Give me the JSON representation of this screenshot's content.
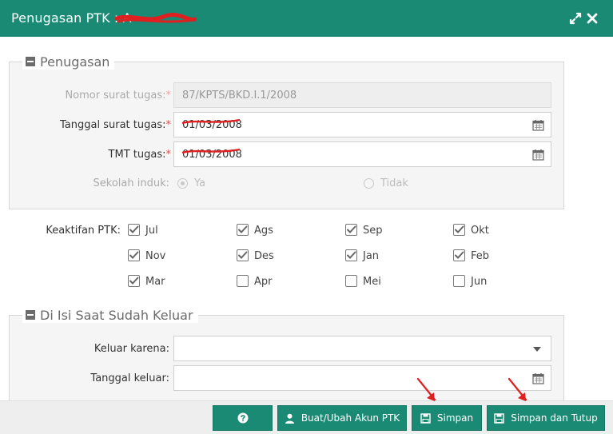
{
  "window": {
    "title": "Penugasan PTK : A",
    "title_redacted": "Setiawan",
    "maximize_icon": "expand-icon",
    "close_icon": "close-icon"
  },
  "penugasan": {
    "legend": "Penugasan",
    "nomor_surat": {
      "label": "Nomor surat tugas:",
      "required": "*",
      "value": "87/KPTS/BKD.I.1/2008"
    },
    "tanggal_surat": {
      "label": "Tanggal surat tugas:",
      "required": "*",
      "value": "01/03/2008"
    },
    "tmt_tugas": {
      "label": "TMT tugas:",
      "required": "*",
      "value": "01/03/2008"
    },
    "sekolah_induk": {
      "label": "Sekolah induk:",
      "option_ya": "Ya",
      "option_tidak": "Tidak",
      "selected": "Ya"
    }
  },
  "keaktifan": {
    "label": "Keaktifan PTK:",
    "months": [
      {
        "name": "Jul",
        "checked": true
      },
      {
        "name": "Ags",
        "checked": true
      },
      {
        "name": "Sep",
        "checked": true
      },
      {
        "name": "Okt",
        "checked": true
      },
      {
        "name": "Nov",
        "checked": true
      },
      {
        "name": "Des",
        "checked": true
      },
      {
        "name": "Jan",
        "checked": true
      },
      {
        "name": "Feb",
        "checked": true
      },
      {
        "name": "Mar",
        "checked": true
      },
      {
        "name": "Apr",
        "checked": false
      },
      {
        "name": "Mei",
        "checked": false
      },
      {
        "name": "Jun",
        "checked": false
      }
    ]
  },
  "keluar": {
    "legend": "Di Isi Saat Sudah Keluar",
    "keluar_karena": {
      "label": "Keluar karena:",
      "value": ""
    },
    "tanggal_keluar": {
      "label": "Tanggal keluar:",
      "value": ""
    }
  },
  "footer": {
    "help_icon": "question-circle-icon",
    "akun_label": "Buat/Ubah Akun PTK",
    "simpan_label": "Simpan",
    "simpan_tutup_label": "Simpan dan Tutup"
  },
  "colors": {
    "accent": "#1a8a74",
    "annotation_red": "#e02020"
  }
}
